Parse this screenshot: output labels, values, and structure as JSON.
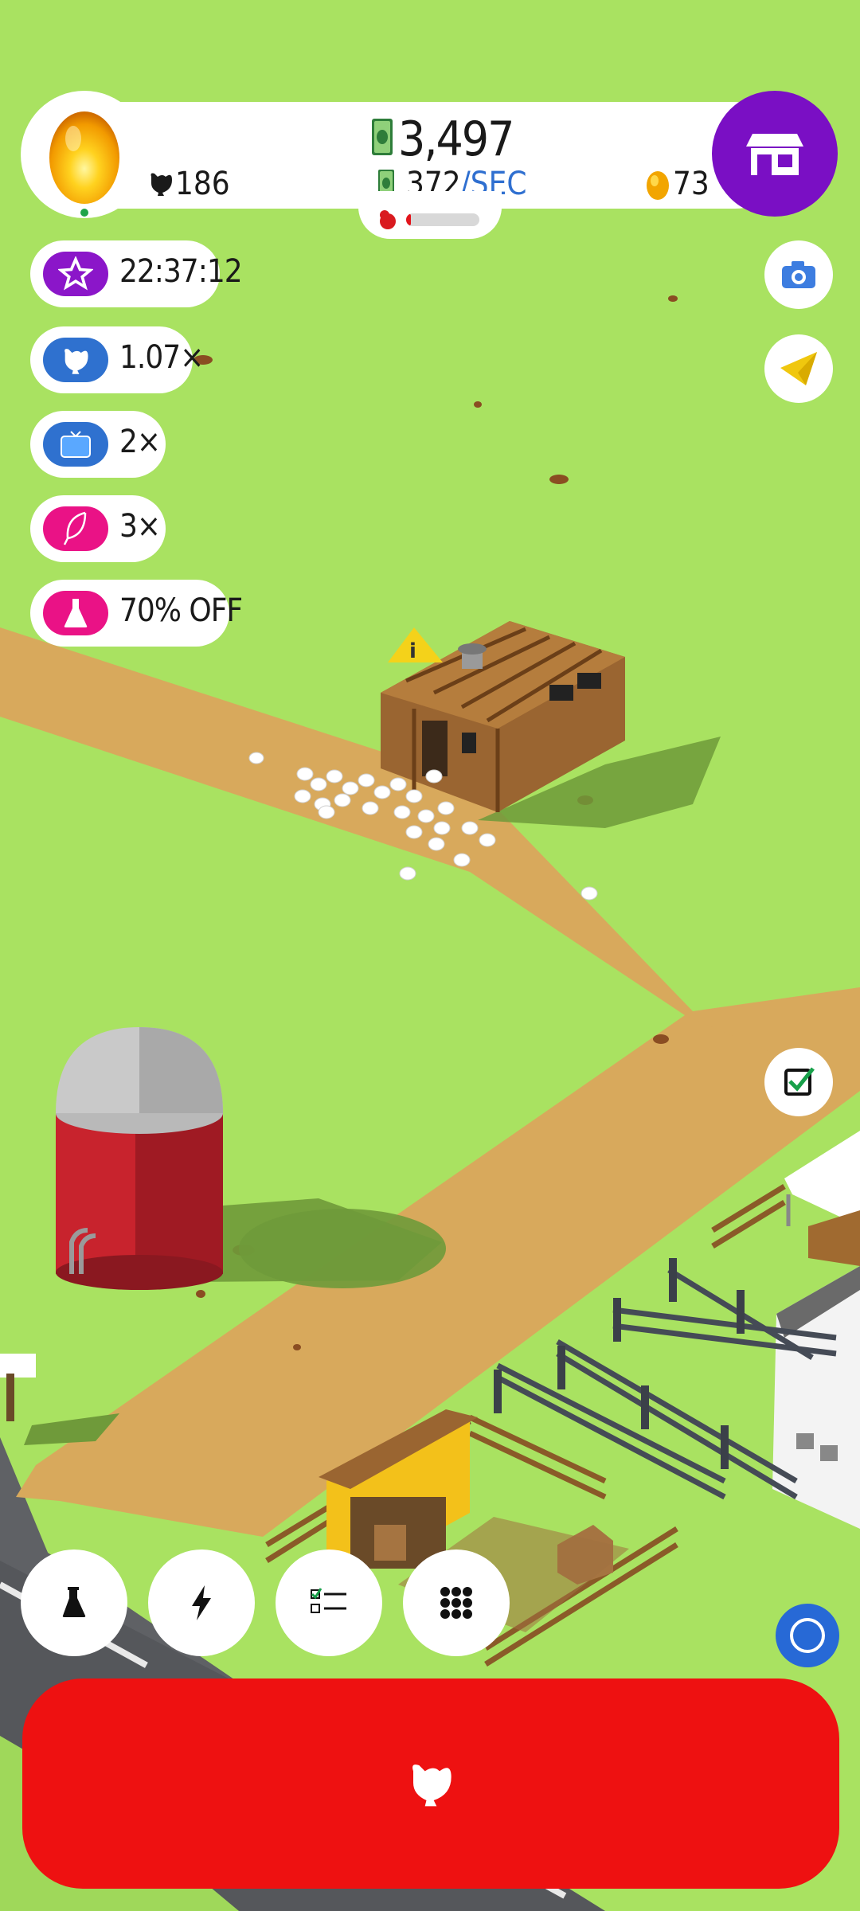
{
  "hud": {
    "money": "3,497",
    "rate_value": "372",
    "rate_unit": "/SEC",
    "chickens": "186",
    "golden_eggs": "73",
    "hatchery_progress": 0.07
  },
  "boosts": [
    {
      "label": "22:37:12",
      "icon": "star-icon",
      "color": "#8b16c9"
    },
    {
      "label": "1.07×",
      "icon": "chicken-icon",
      "color": "#2f71cf"
    },
    {
      "label": "2×",
      "icon": "video-icon",
      "color": "#2f71cf"
    },
    {
      "label": "3×",
      "icon": "feather-icon",
      "color": "#ea1286"
    },
    {
      "label": "70% OFF",
      "icon": "flask-icon",
      "color": "#ea1286"
    }
  ],
  "actions": [
    "research-icon",
    "boost-icon",
    "missions-icon",
    "menu-grid-icon"
  ],
  "colors": {
    "grass": "#a9e261",
    "shop": "#7a0fc4",
    "hatch_button": "#ee1111",
    "blue_accent": "#2769d6"
  }
}
